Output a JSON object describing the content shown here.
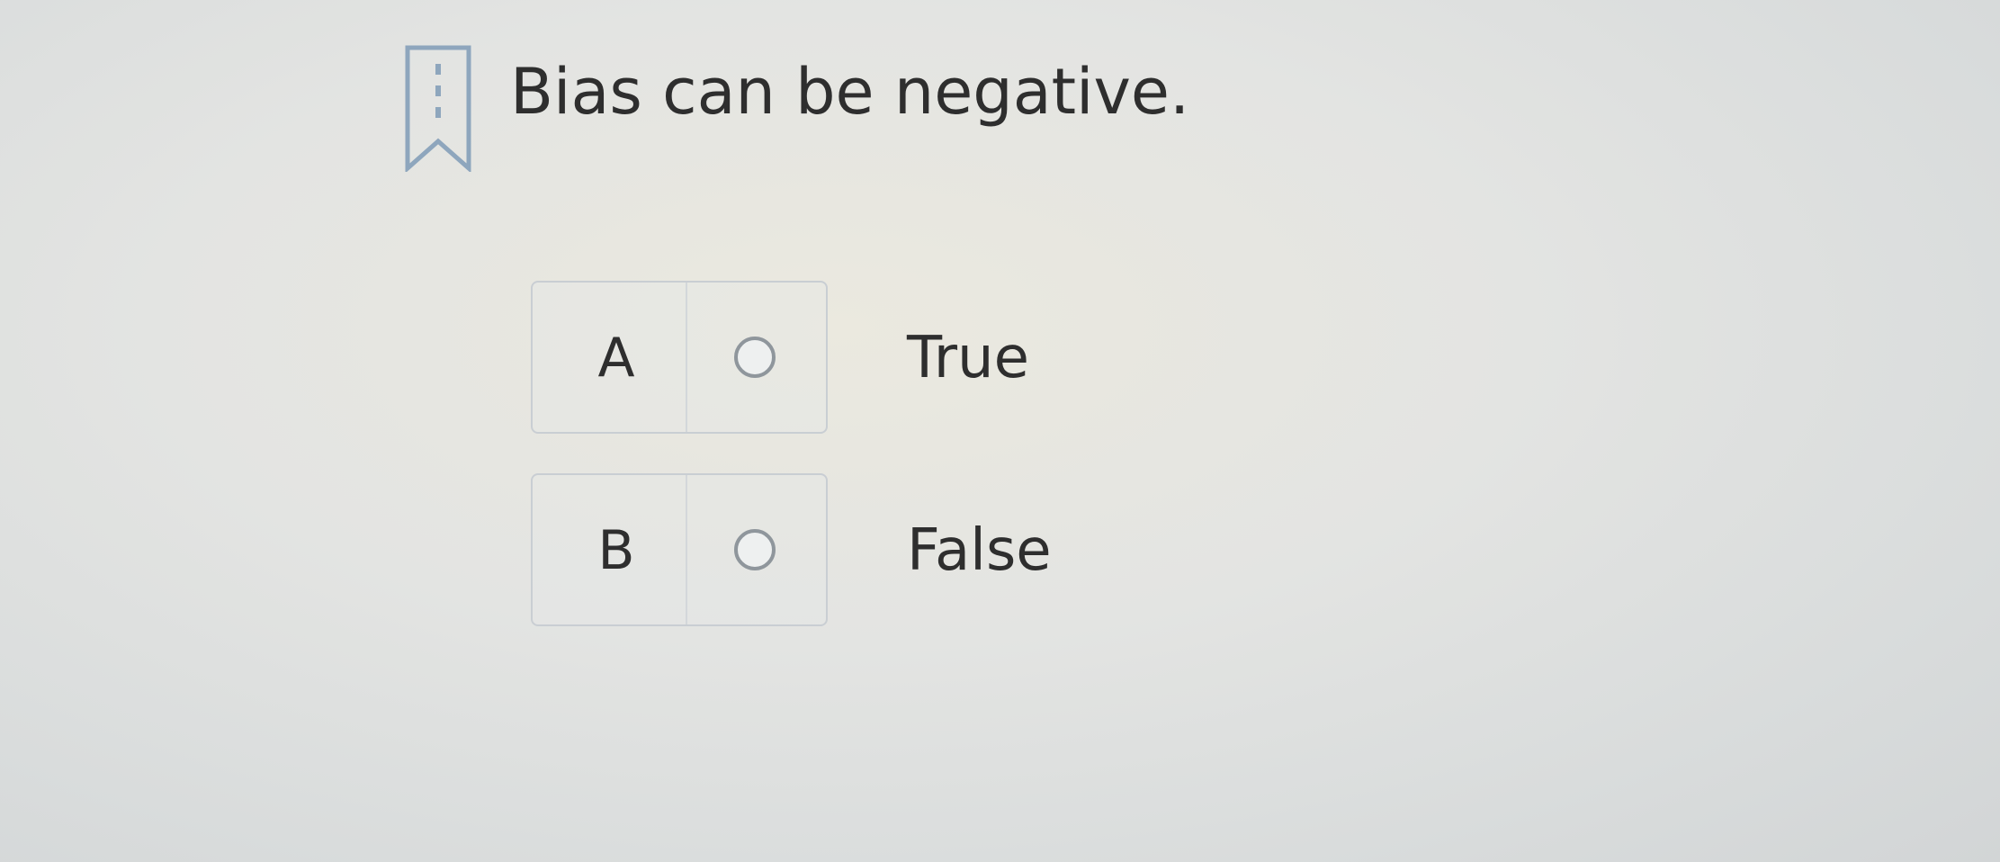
{
  "question": {
    "text": "Bias can be negative."
  },
  "options": [
    {
      "letter": "A",
      "label": "True",
      "selected": false
    },
    {
      "letter": "B",
      "label": "False",
      "selected": false
    }
  ],
  "icons": {
    "bookmark": "bookmark-icon",
    "radio": "radio-icon"
  },
  "colors": {
    "bookmark": "#8ea6bd",
    "radio_border": "#8f969c",
    "text": "#2e2e2e"
  }
}
